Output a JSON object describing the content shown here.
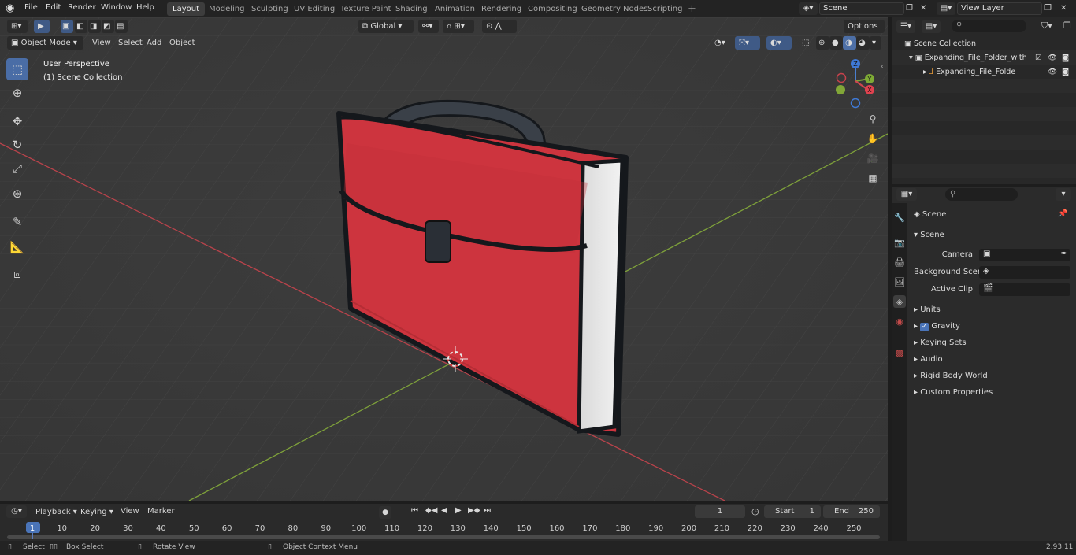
{
  "topbar": {
    "menus": [
      "File",
      "Edit",
      "Render",
      "Window",
      "Help"
    ],
    "workspaces": [
      "Layout",
      "Modeling",
      "Sculpting",
      "UV Editing",
      "Texture Paint",
      "Shading",
      "Animation",
      "Rendering",
      "Compositing",
      "Geometry Nodes",
      "Scripting"
    ],
    "active_workspace": "Layout",
    "add_tab": "+",
    "scene_name": "Scene",
    "view_layer": "View Layer"
  },
  "viewport_header": {
    "mode": "Object Mode",
    "menus": [
      "View",
      "Select",
      "Add",
      "Object"
    ],
    "transform_orientation": "Global",
    "options": "Options"
  },
  "viewport": {
    "perspective": "User Perspective",
    "collection": "(1) Scene Collection",
    "gizmo_axes": {
      "z": "Z",
      "y": "Y",
      "x": "X"
    },
    "colors": {
      "grid_bg": "#3c3c3c",
      "x_axis": "#c8434a",
      "y_axis": "#7fa638",
      "object_red": "#cc333d",
      "outline": "#1a1d21"
    }
  },
  "outliner": {
    "search_placeholder": "",
    "root": "Scene Collection",
    "items": [
      {
        "name": "Expanding_File_Folder_with_I",
        "icon": "collection-icon"
      },
      {
        "name": "Expanding_File_Folder_w",
        "icon": "empty-icon"
      }
    ]
  },
  "properties": {
    "context": "Scene",
    "panel": "Scene",
    "fields": [
      {
        "label": "Camera",
        "value": ""
      },
      {
        "label": "Background Scene",
        "value": ""
      },
      {
        "label": "Active Clip",
        "value": ""
      }
    ],
    "subpanels": [
      "Units",
      "Gravity",
      "Keying Sets",
      "Audio",
      "Rigid Body World",
      "Custom Properties"
    ],
    "gravity_checked": true
  },
  "timeline": {
    "menus": [
      "Playback",
      "Keying",
      "View",
      "Marker"
    ],
    "current_frame": "1",
    "start_label": "Start",
    "start": "1",
    "end_label": "End",
    "end": "250",
    "ticks": [
      "1",
      "10",
      "20",
      "30",
      "40",
      "50",
      "60",
      "70",
      "80",
      "90",
      "100",
      "110",
      "120",
      "130",
      "140",
      "150",
      "160",
      "170",
      "180",
      "190",
      "200",
      "210",
      "220",
      "230",
      "240",
      "250"
    ]
  },
  "statusbar": {
    "select": "Select",
    "box_select": "Box Select",
    "rotate_view": "Rotate View",
    "context_menu": "Object Context Menu",
    "version": "2.93.11"
  }
}
